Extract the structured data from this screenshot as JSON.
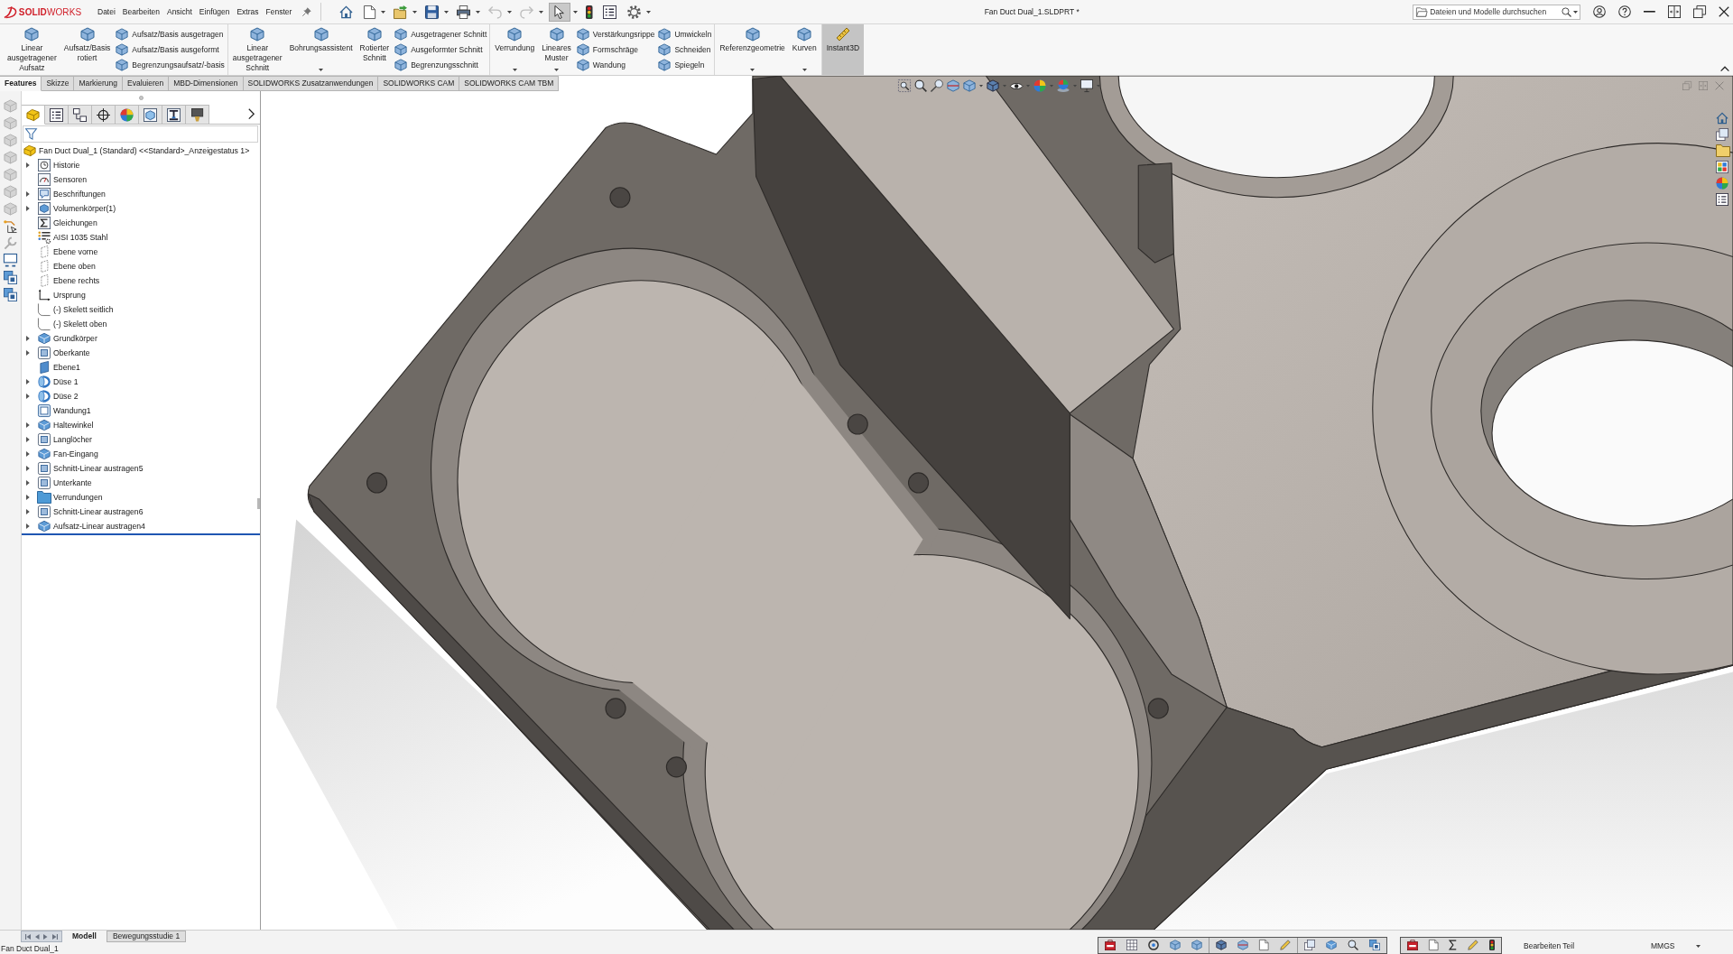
{
  "app": {
    "logo": "**SOLID**WORKS",
    "document_title": "Fan Duct Dual_1.SLDPRT *"
  },
  "menu": [
    "Datei",
    "Bearbeiten",
    "Ansicht",
    "Einfügen",
    "Extras",
    "Fenster"
  ],
  "quick_access": [
    {
      "kind": "home",
      "dropdown": false,
      "disabled": false,
      "selected": false
    },
    {
      "kind": "new",
      "dropdown": true,
      "disabled": false,
      "selected": false
    },
    {
      "kind": "open",
      "dropdown": true,
      "disabled": false,
      "selected": false
    },
    {
      "kind": "save",
      "dropdown": true,
      "disabled": false,
      "selected": false
    },
    {
      "kind": "print",
      "dropdown": true,
      "disabled": false,
      "selected": false
    },
    {
      "kind": "undo",
      "dropdown": true,
      "disabled": true,
      "selected": false
    },
    {
      "kind": "redo",
      "dropdown": true,
      "disabled": true,
      "selected": false
    },
    {
      "kind": "select",
      "dropdown": true,
      "disabled": false,
      "selected": true
    },
    {
      "kind": "rebuild",
      "dropdown": false,
      "disabled": false,
      "selected": false
    },
    {
      "kind": "file-properties",
      "dropdown": false,
      "disabled": false,
      "selected": false
    },
    {
      "kind": "options",
      "dropdown": true,
      "disabled": false,
      "selected": false
    }
  ],
  "search": {
    "placeholder": "Dateien und Modelle durchsuchen"
  },
  "ribbon": [
    {
      "items": [
        {
          "kind": "large",
          "label": "Linear ausgetragener Aufsatz",
          "dropdown": false
        },
        {
          "kind": "large",
          "label": "Aufsatz/Basis rotiert",
          "dropdown": false
        },
        {
          "kind": "stack",
          "items": [
            "Aufsatz/Basis ausgetragen",
            "Aufsatz/Basis ausgeformt",
            "Begrenzungsaufsatz/-basis"
          ]
        }
      ]
    },
    {
      "items": [
        {
          "kind": "large",
          "label": "Linear ausgetragener Schnitt",
          "dropdown": false
        },
        {
          "kind": "large",
          "label": "Bohrungsassistent",
          "dropdown": true
        },
        {
          "kind": "large",
          "label": "Rotierter Schnitt",
          "dropdown": false
        },
        {
          "kind": "stack",
          "items": [
            "Ausgetragener Schnitt",
            "Ausgeformter Schnitt",
            "Begrenzungsschnitt"
          ]
        }
      ]
    },
    {
      "items": [
        {
          "kind": "large",
          "label": "Verrundung",
          "dropdown": true
        },
        {
          "kind": "large",
          "label": "Lineares Muster",
          "dropdown": true
        },
        {
          "kind": "stack",
          "items": [
            "Verstärkungsrippe",
            "Formschräge",
            "Wandung"
          ]
        },
        {
          "kind": "stack",
          "items": [
            "Umwickeln",
            "Schneiden",
            "Spiegeln"
          ]
        }
      ]
    },
    {
      "items": [
        {
          "kind": "large",
          "label": "Referenzgeometrie",
          "dropdown": true
        },
        {
          "kind": "large",
          "label": "Kurven",
          "dropdown": true
        }
      ]
    },
    {
      "items": [
        {
          "kind": "toggle",
          "label": "Instant3D",
          "on": true
        }
      ]
    }
  ],
  "command_tabs": [
    {
      "label": "Features",
      "selected": true
    },
    {
      "label": "Skizze",
      "selected": false
    },
    {
      "label": "Markierung",
      "selected": false
    },
    {
      "label": "Evaluieren",
      "selected": false
    },
    {
      "label": "MBD-Dimensionen",
      "selected": false
    },
    {
      "label": "SOLIDWORKS Zusatzanwendungen",
      "selected": false
    },
    {
      "label": "SOLIDWORKS CAM",
      "selected": false
    },
    {
      "label": "SOLIDWORKS CAM TBM",
      "selected": false
    }
  ],
  "side_toolbar": [
    {
      "kind": "view",
      "disabled": true
    },
    {
      "kind": "view",
      "disabled": true
    },
    {
      "kind": "view",
      "disabled": true
    },
    {
      "kind": "view",
      "disabled": true
    },
    {
      "kind": "view",
      "disabled": true
    },
    {
      "kind": "view",
      "disabled": true
    },
    {
      "kind": "view",
      "disabled": true
    },
    {
      "kind": "sketch",
      "disabled": false
    },
    {
      "kind": "tool",
      "disabled": true
    },
    {
      "kind": "screen",
      "disabled": false
    },
    {
      "kind": "copy",
      "disabled": false
    },
    {
      "kind": "copy",
      "disabled": false
    }
  ],
  "panel_tabs": [
    {
      "kind": "feature-manager",
      "selected": true
    },
    {
      "kind": "property-manager",
      "selected": false
    },
    {
      "kind": "configuration-manager",
      "selected": false
    },
    {
      "kind": "dimxpert",
      "selected": false
    },
    {
      "kind": "display-manager",
      "selected": false
    },
    {
      "kind": "cam-feature",
      "selected": false
    },
    {
      "kind": "cam-operation",
      "selected": false
    },
    {
      "kind": "cam-tool",
      "selected": false
    }
  ],
  "feature_tree": {
    "root": "Fan Duct Dual_1 (Standard) <<Standard>_Anzeigestatus 1>",
    "items": [
      {
        "label": "Historie",
        "kind": "history",
        "expandable": true
      },
      {
        "label": "Sensoren",
        "kind": "sensor",
        "expandable": false
      },
      {
        "label": "Beschriftungen",
        "kind": "annotations",
        "expandable": true
      },
      {
        "label": "Volumenkörper(1)",
        "kind": "bodies",
        "expandable": true
      },
      {
        "label": "Gleichungen",
        "kind": "equations",
        "expandable": false
      },
      {
        "label": "AISI 1035 Stahl",
        "kind": "material",
        "expandable": false
      },
      {
        "label": "Ebene vorne",
        "kind": "plane",
        "expandable": false
      },
      {
        "label": "Ebene oben",
        "kind": "plane",
        "expandable": false
      },
      {
        "label": "Ebene rechts",
        "kind": "plane",
        "expandable": false
      },
      {
        "label": "Ursprung",
        "kind": "origin",
        "expandable": false
      },
      {
        "label": "(-) Skelett seitlich",
        "kind": "sketch",
        "expandable": false
      },
      {
        "label": "(-) Skelett oben",
        "kind": "sketch",
        "expandable": false
      },
      {
        "label": "Grundkörper",
        "kind": "extrude",
        "expandable": true
      },
      {
        "label": "Oberkante",
        "kind": "cut",
        "expandable": true
      },
      {
        "label": "Ebene1",
        "kind": "ref-plane",
        "expandable": false
      },
      {
        "label": "Düse 1",
        "kind": "revolve",
        "expandable": true
      },
      {
        "label": "Düse 2",
        "kind": "revolve",
        "expandable": true
      },
      {
        "label": "Wandung1",
        "kind": "shell",
        "expandable": false
      },
      {
        "label": "Haltewinkel",
        "kind": "extrude",
        "expandable": true
      },
      {
        "label": "Langlöcher",
        "kind": "cut",
        "expandable": true
      },
      {
        "label": "Fan-Eingang",
        "kind": "extrude",
        "expandable": true
      },
      {
        "label": "Schnitt-Linear austragen5",
        "kind": "cut",
        "expandable": true
      },
      {
        "label": "Unterkante",
        "kind": "cut",
        "expandable": true
      },
      {
        "label": "Verrundungen",
        "kind": "folder",
        "expandable": true
      },
      {
        "label": "Schnitt-Linear austragen6",
        "kind": "cut",
        "expandable": true
      },
      {
        "label": "Aufsatz-Linear austragen4",
        "kind": "extrude",
        "expandable": true
      }
    ]
  },
  "bottom_tabs": [
    {
      "label": "Modell",
      "selected": true
    },
    {
      "label": "Bewegungsstudie 1",
      "selected": false
    }
  ],
  "status_bar": {
    "document": "Fan Duct Dual_1",
    "mode": "Bearbeiten Teil",
    "units": "MMGS"
  }
}
